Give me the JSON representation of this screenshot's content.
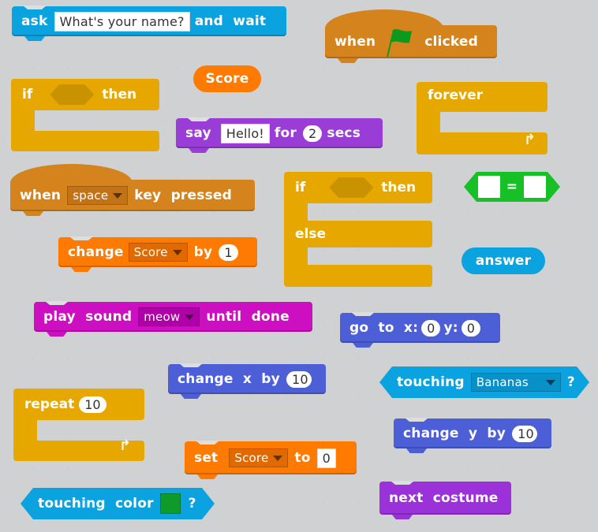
{
  "canvas": {
    "title": "Scratch scripts area",
    "background": "#dcdedf"
  },
  "colors": {
    "control": "#e6a800",
    "events": "#d4831d",
    "looks": "#9a3cd6",
    "variables": "#ff7a00",
    "sensing": "#0aa3e0",
    "sound": "#cc0fc0",
    "motion": "#4d5fd6",
    "operators": "#16c026",
    "flag": "#0c9a1e",
    "color_swatch": "#0e9b2a"
  },
  "blocks": {
    "ask": {
      "prefix": "ask",
      "input": "What's your name?",
      "suffix": "and  wait"
    },
    "when_flag": {
      "prefix": "when",
      "icon": "green-flag-icon",
      "suffix": "clicked"
    },
    "if_then": {
      "prefix": "if",
      "suffix": "then"
    },
    "score_reporter": {
      "label": "Score"
    },
    "say": {
      "prefix": "say",
      "input": "Hello!",
      "mid": "for",
      "number": "2",
      "suffix": "secs"
    },
    "forever": {
      "label": "forever",
      "icon": "loop-arrow-icon"
    },
    "when_key": {
      "prefix": "when",
      "dropdown": "space",
      "suffix": "key  pressed"
    },
    "if_else": {
      "prefix": "if",
      "suffix": "then",
      "else": "else"
    },
    "equals": {
      "operator": "="
    },
    "change_var": {
      "prefix": "change",
      "dropdown": "Score",
      "mid": "by",
      "number": "1"
    },
    "answer": {
      "label": "answer"
    },
    "play_sound": {
      "prefix": "play  sound",
      "dropdown": "meow",
      "suffix": "until  done"
    },
    "go_to": {
      "prefix": "go  to  x:",
      "x": "0",
      "mid": "y:",
      "y": "0"
    },
    "change_x": {
      "prefix": "change  x  by",
      "number": "10"
    },
    "touching": {
      "prefix": "touching",
      "dropdown": "Bananas",
      "suffix": "?"
    },
    "repeat": {
      "prefix": "repeat",
      "number": "10",
      "icon": "loop-arrow-icon"
    },
    "change_y": {
      "prefix": "change  y  by",
      "number": "10"
    },
    "set_var": {
      "prefix": "set",
      "dropdown": "Score",
      "mid": "to",
      "input": "0"
    },
    "touching_color": {
      "prefix": "touching  color",
      "suffix": "?"
    },
    "next_costume": {
      "label": "next  costume"
    }
  }
}
